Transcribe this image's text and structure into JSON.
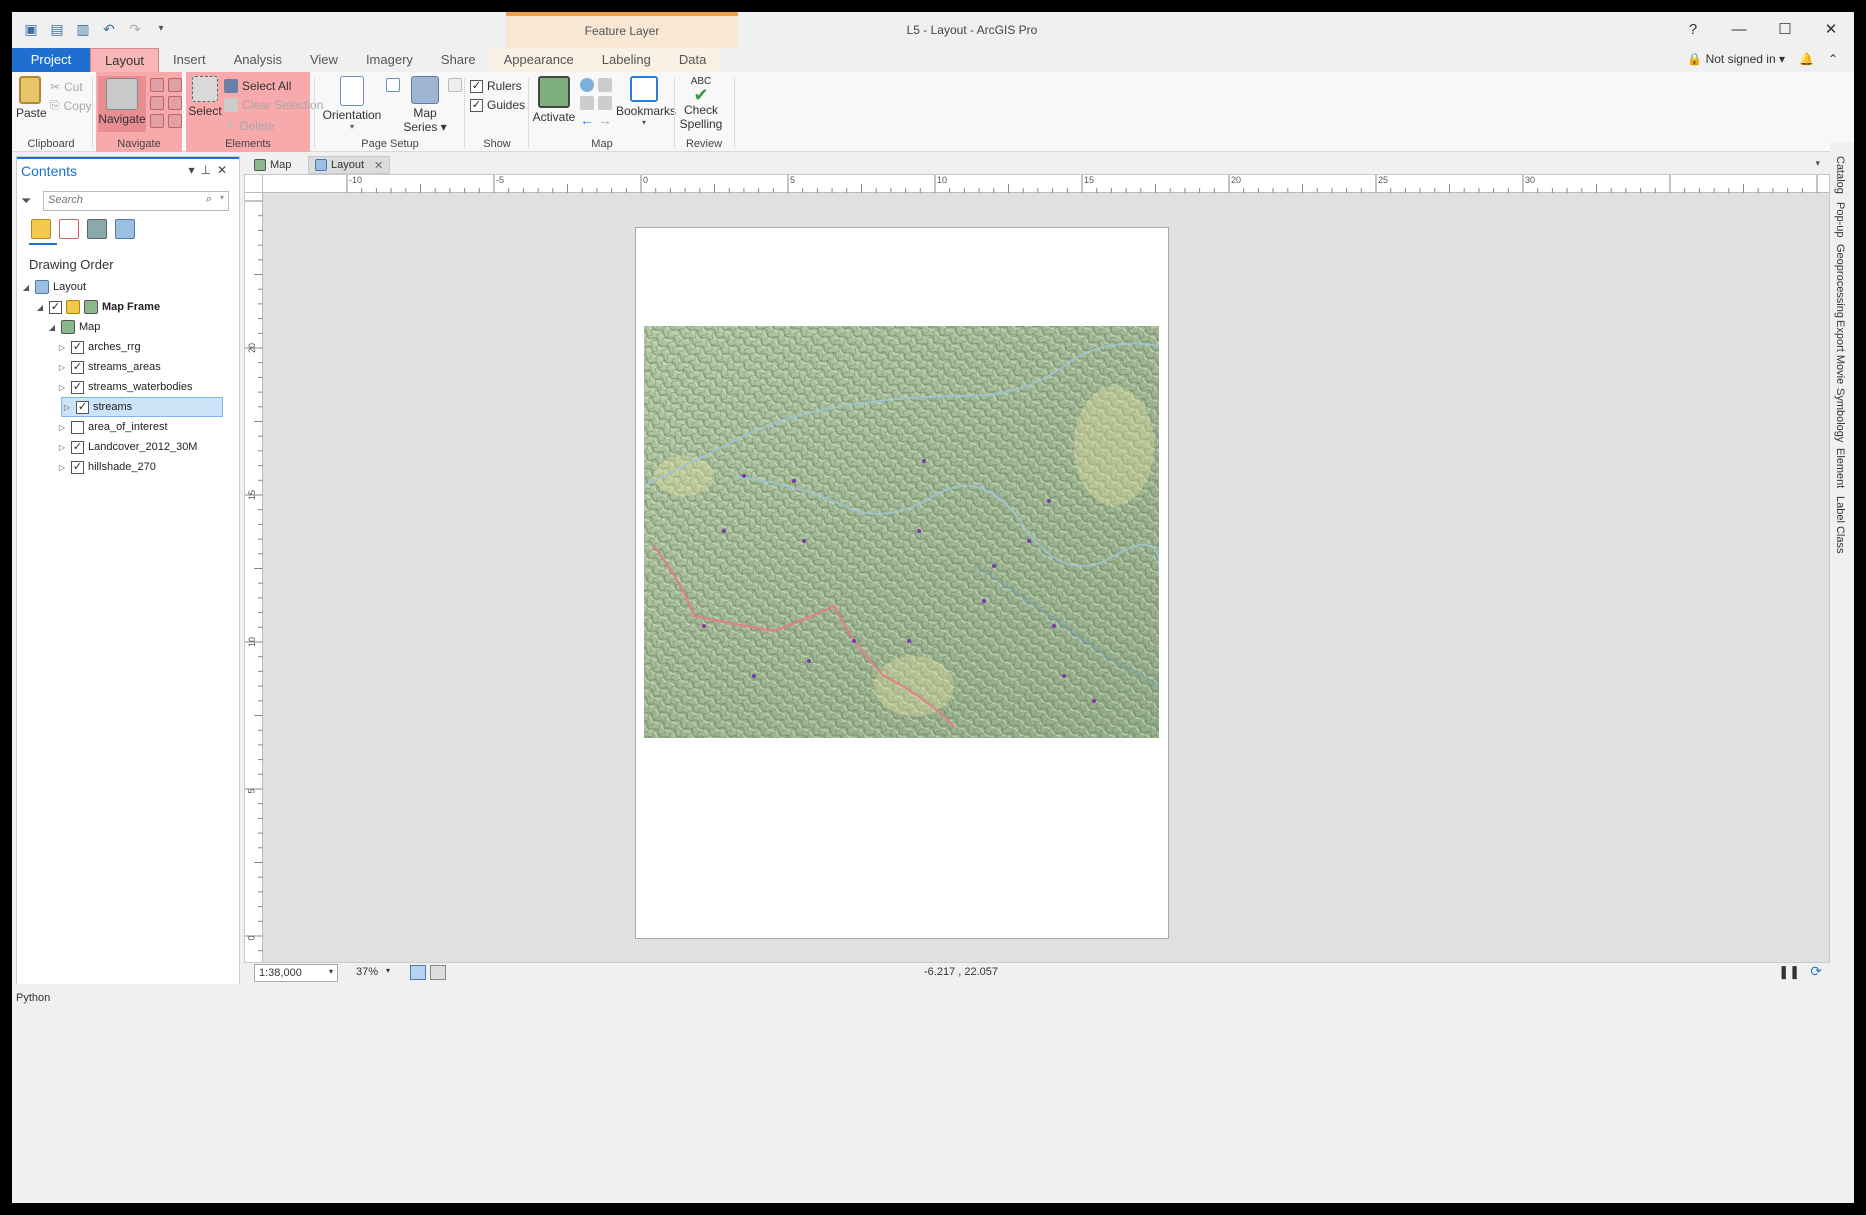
{
  "window": {
    "title": "L5 - Layout - ArcGIS Pro",
    "contextual_header": "Feature Layer",
    "help": "?",
    "minimize": "—",
    "maximize": "☐",
    "close": "✕"
  },
  "ribbon_tabs": [
    "Project",
    "Layout",
    "Insert",
    "Analysis",
    "View",
    "Imagery",
    "Share",
    "Appearance",
    "Labeling",
    "Data"
  ],
  "account": {
    "status": "Not signed in"
  },
  "ribbon": {
    "clipboard": {
      "paste": "Paste",
      "cut": "Cut",
      "copy": "Copy",
      "label": "Clipboard"
    },
    "navigate": {
      "navigate": "Navigate",
      "label": "Navigate"
    },
    "elements": {
      "select": "Select",
      "select_all": "Select All",
      "clear_selection": "Clear Selection",
      "delete": "Delete",
      "label": "Elements"
    },
    "page_setup": {
      "orientation": "Orientation",
      "map_series_line1": "Map",
      "map_series_line2": "Series",
      "label": "Page Setup"
    },
    "show": {
      "rulers": "Rulers",
      "guides": "Guides",
      "label": "Show"
    },
    "map": {
      "activate": "Activate",
      "bookmarks": "Bookmarks",
      "label": "Map"
    },
    "review": {
      "abc": "ABC",
      "check_line1": "Check",
      "check_line2": "Spelling",
      "label": "Review"
    }
  },
  "contents": {
    "title": "Contents",
    "search_placeholder": "Search",
    "drawing_order": "Drawing Order",
    "layout": "Layout",
    "map_frame": "Map Frame",
    "map": "Map",
    "layers": [
      {
        "name": "arches_rrg",
        "checked": true
      },
      {
        "name": "streams_areas",
        "checked": true
      },
      {
        "name": "streams_waterbodies",
        "checked": true
      },
      {
        "name": "streams",
        "checked": true
      },
      {
        "name": "area_of_interest",
        "checked": false
      },
      {
        "name": "Landcover_2012_30M",
        "checked": true
      },
      {
        "name": "hillshade_270",
        "checked": true
      }
    ]
  },
  "doc_tabs": {
    "map": "Map",
    "layout": "Layout"
  },
  "ruler": {
    "h_labels": [
      "-10",
      "-5",
      "0",
      "5",
      "10",
      "15",
      "20",
      "25",
      "30"
    ],
    "v_labels": [
      "20",
      "15",
      "10",
      "5",
      "0"
    ]
  },
  "status": {
    "scale": "1:38,000",
    "zoom": "37%",
    "coords": "-6.217 , 22.057"
  },
  "right_panes": [
    "Catalog",
    "Pop-up",
    "Geoprocessing",
    "Export Movie",
    "Symbology",
    "Element",
    "Label Class"
  ],
  "python": "Python",
  "colors": {
    "accent": "#1e6fd0",
    "highlight": "#f7a9ac",
    "contextual": "#f0a04b",
    "selection": "#cce4f7"
  }
}
